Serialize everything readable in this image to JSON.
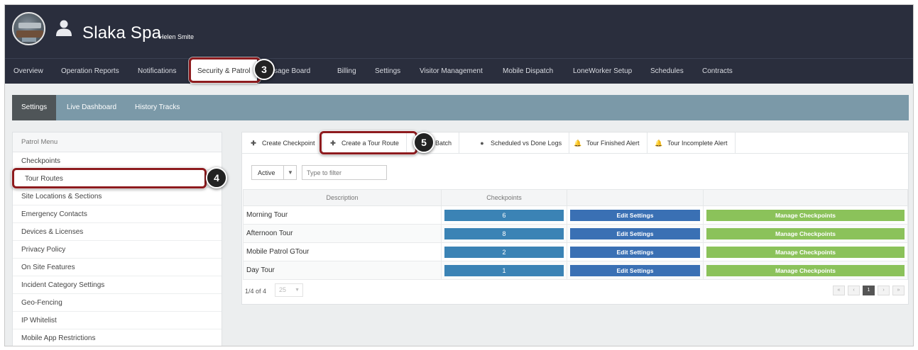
{
  "header": {
    "company_name": "Slaka Spa",
    "user_name": "Helen Smite"
  },
  "nav": {
    "items": [
      {
        "label": "Overview"
      },
      {
        "label": "Operation Reports"
      },
      {
        "label": "Notifications"
      },
      {
        "label": "Security & Patrol"
      },
      {
        "label": "Message Board"
      },
      {
        "label": "Billing"
      },
      {
        "label": "Settings"
      },
      {
        "label": "Visitor Management"
      },
      {
        "label": "Mobile Dispatch"
      },
      {
        "label": "LoneWorker Setup"
      },
      {
        "label": "Schedules"
      },
      {
        "label": "Contracts"
      }
    ],
    "active": "Security & Patrol",
    "visible_text": {
      "security": "Security & Patrol",
      "message": "ssage Board"
    }
  },
  "subnav": {
    "items": [
      {
        "label": "Settings"
      },
      {
        "label": "Live Dashboard"
      },
      {
        "label": "History Tracks"
      }
    ]
  },
  "sidebar": {
    "title": "Patrol Menu",
    "items": [
      {
        "label": "Checkpoints"
      },
      {
        "label": "Tour Routes"
      },
      {
        "label": "Site Locations & Sections"
      },
      {
        "label": "Emergency Contacts"
      },
      {
        "label": "Devices & Licenses"
      },
      {
        "label": "Privacy Policy"
      },
      {
        "label": "On Site Features"
      },
      {
        "label": "Incident Category Settings"
      },
      {
        "label": "Geo-Fencing"
      },
      {
        "label": "IP Whitelist"
      },
      {
        "label": "Mobile App Restrictions"
      }
    ]
  },
  "toolbar": {
    "create_checkpoint": "Create Checkpoint",
    "create_tour_route": "Create a Tour Route",
    "start_batch": "rt Batch",
    "scheduled_vs_done": "Scheduled vs Done Logs",
    "tour_finished_alert": "Tour Finished Alert",
    "tour_incomplete_alert": "Tour Incomplete Alert"
  },
  "filter": {
    "status_value": "Active",
    "search_placeholder": "Type to filter"
  },
  "table": {
    "columns": {
      "description": "Description",
      "checkpoints": "Checkpoints"
    },
    "edit_label": "Edit Settings",
    "manage_label": "Manage Checkpoints",
    "rows": [
      {
        "description": "Morning Tour",
        "checkpoints": "6"
      },
      {
        "description": "Afternoon Tour",
        "checkpoints": "8"
      },
      {
        "description": "Mobile Patrol GTour",
        "checkpoints": "2"
      },
      {
        "description": "Day Tour",
        "checkpoints": "1"
      }
    ]
  },
  "pager": {
    "summary": "1/4 of 4",
    "page_size": "25",
    "current_page": "1",
    "first": "«",
    "prev": "‹",
    "next": "›",
    "last": "»"
  },
  "annotations": {
    "step3": "3",
    "step4": "4",
    "step5": "5"
  },
  "colors": {
    "header_bg": "#2a2e3d",
    "subnav_bg": "#7b99a8",
    "count_blue": "#3b83b5",
    "edit_blue": "#3a70b4",
    "manage_green": "#8bc25a",
    "highlight_red": "#8e1b1e"
  }
}
